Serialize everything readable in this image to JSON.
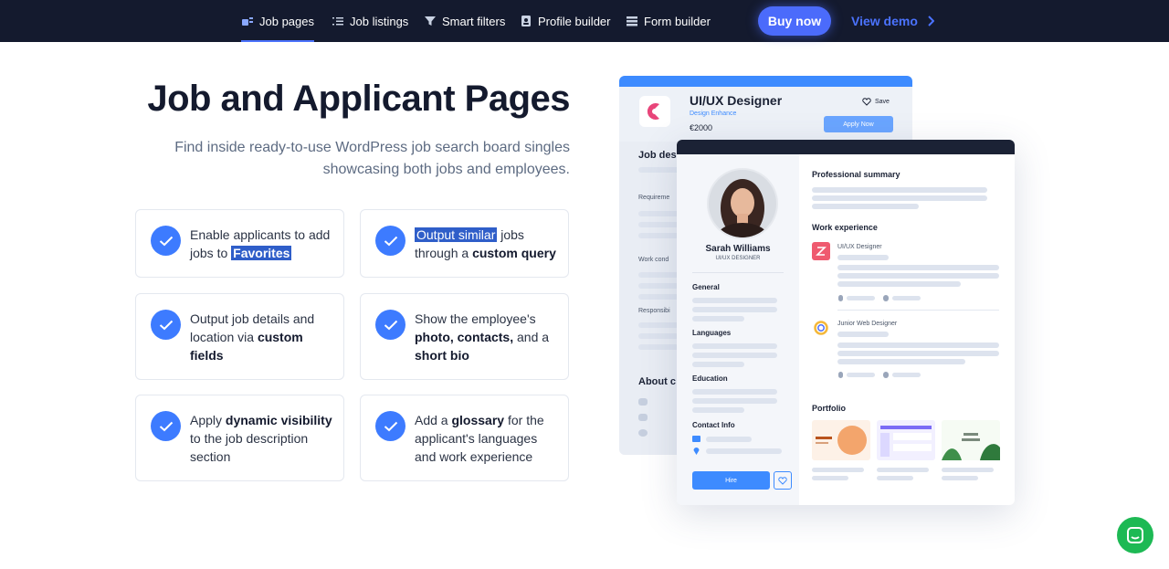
{
  "nav": {
    "items": [
      {
        "label": "Job pages",
        "icon": "job-pages-icon",
        "active": true
      },
      {
        "label": "Job listings",
        "icon": "list-icon",
        "active": false
      },
      {
        "label": "Smart filters",
        "icon": "filter-icon",
        "active": false
      },
      {
        "label": "Profile builder",
        "icon": "profile-icon",
        "active": false
      },
      {
        "label": "Form builder",
        "icon": "form-icon",
        "active": false
      }
    ],
    "buy_label": "Buy now",
    "demo_label": "View demo"
  },
  "hero": {
    "title": "Job and Applicant Pages",
    "subtitle_line1": "Find inside ready-to-use WordPress job search board singles",
    "subtitle_line2": "showcasing both jobs and employees."
  },
  "features": {
    "f1": {
      "pre": "Enable applicants to add jobs to ",
      "bold": "Favorites"
    },
    "f2": {
      "hl": "Output similar",
      "pre": " jobs through a ",
      "bold": "custom query"
    },
    "f3": {
      "pre": "Output job details and location via ",
      "bold": "custom fields"
    },
    "f4": {
      "pre": "Show the employee's ",
      "bold1": "photo, contacts,",
      "mid": " and a ",
      "bold2": "short bio"
    },
    "f5": {
      "pre": "Apply ",
      "bold": "dynamic visibility",
      "post": " to the job description section"
    },
    "f6": {
      "pre": "Add a ",
      "bold": "glossary",
      "post": " for the applicant's languages and work experience"
    }
  },
  "mockup": {
    "job_title": "UI/UX Designer",
    "company": "Design Enhance",
    "salary": "€2000",
    "save_label": "Save",
    "apply_label": "Apply Now",
    "back_sections": {
      "desc": "Job des",
      "req": "Requireme",
      "work": "Work cond",
      "resp": "Responsibi",
      "about": "About c"
    },
    "applicant_name": "Sarah Williams",
    "applicant_role": "UI/UX DESIGNER",
    "side_sections": {
      "general": "General",
      "languages": "Languages",
      "education": "Education",
      "contact": "Contact Info"
    },
    "hire_label": "Hire",
    "summary_heading": "Professional summary",
    "work_heading": "Work experience",
    "job1": "UI/UX Designer",
    "job2": "Junior Web Designer",
    "portfolio_heading": "Portfolio"
  },
  "colors": {
    "nav_bg": "#141a2e",
    "accent": "#4b6bfb",
    "check": "#3d7bff",
    "chat": "#1db954"
  }
}
